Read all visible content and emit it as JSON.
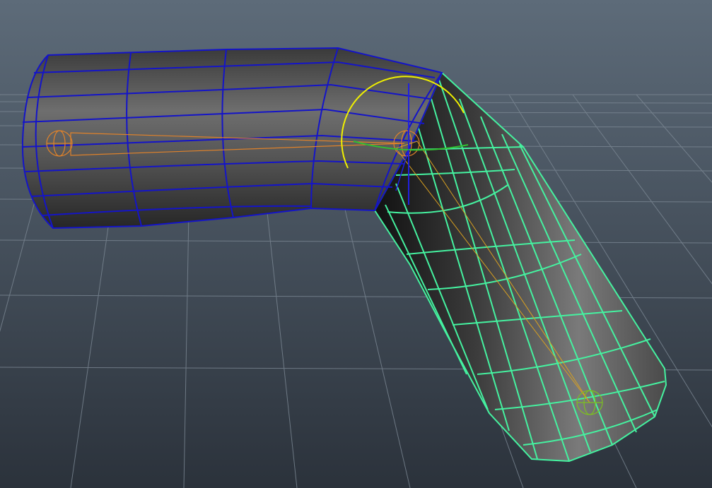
{
  "viewport": {
    "background_top": "#5d6b79",
    "background_bottom": "#2c333c",
    "grid_color": "#7c8894",
    "mesh_upper_wire_color": "#1414c8",
    "mesh_lower_wire_color": "#45f2a0",
    "rotate_manipulator_color": "#f0f000",
    "joint_color": "#e0822a",
    "end_joint_color": "#7cc020"
  },
  "scene": {
    "upper_segment": "upper-arm-mesh",
    "lower_segment": "lower-arm-mesh",
    "joints": [
      "root-joint",
      "elbow-joint",
      "end-joint"
    ]
  }
}
